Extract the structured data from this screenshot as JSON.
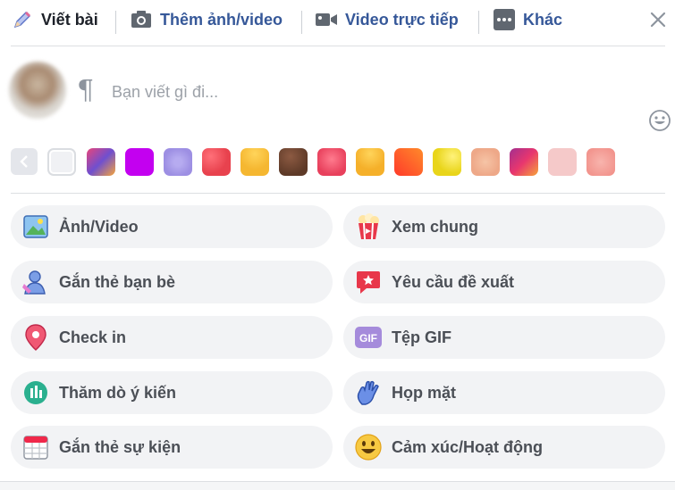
{
  "tabs": {
    "write": "Viết bài",
    "photo": "Thêm ảnh/video",
    "live": "Video trực tiếp",
    "more": "Khác"
  },
  "composer": {
    "placeholder": "Bạn viết gì đi..."
  },
  "swatches": [
    "#f0f1f4",
    "#6d4c9e",
    "#c300f0",
    "#a99be8",
    "#e8424e",
    "#f5b731",
    "#6b4330",
    "#e84b63",
    "#f5b731",
    "#ff5a1f",
    "#efdf1a",
    "#f2b79a",
    "#d6367a",
    "#f5c6c6",
    "#f4a6a0"
  ],
  "actions": {
    "left": [
      "Ảnh/Video",
      "Gắn thẻ bạn bè",
      "Check in",
      "Thăm dò ý kiến",
      "Gắn thẻ sự kiện"
    ],
    "right": [
      "Xem chung",
      "Yêu cầu đề xuất",
      "Tệp GIF",
      "Họp mặt",
      "Cảm xúc/Hoạt động"
    ]
  },
  "icons": {
    "write": "pencil-icon",
    "photo": "camera-icon",
    "live": "video-camera-icon",
    "more": "more-dots-icon",
    "close": "close-icon",
    "emoji": "smiley-icon",
    "left": [
      "photo-icon",
      "tag-friends-icon",
      "location-pin-icon",
      "poll-icon",
      "calendar-icon"
    ],
    "right": [
      "popcorn-icon",
      "recommendation-icon",
      "gif-icon",
      "wave-hand-icon",
      "smiley-face-icon"
    ]
  },
  "colors": {
    "link": "#365899",
    "pill_bg": "#f2f3f5",
    "divider": "#dddfe2"
  }
}
